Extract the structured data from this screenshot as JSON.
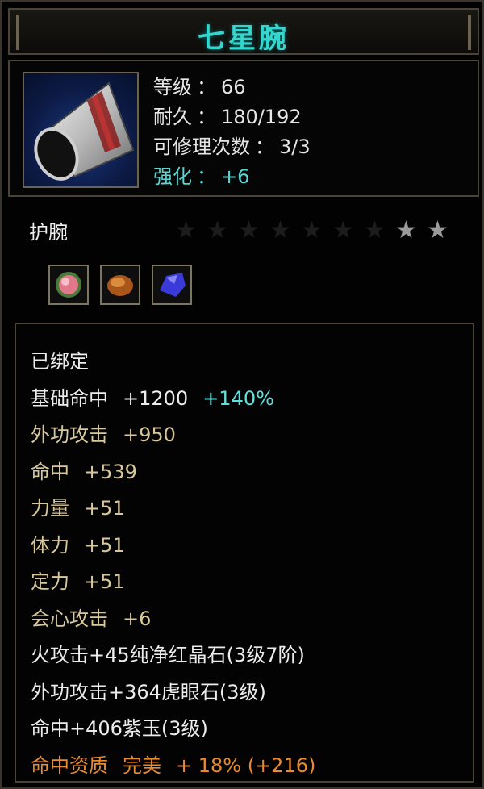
{
  "title": "七星腕",
  "header": {
    "level_label": "等级",
    "level_value": "66",
    "durability_label": "耐久",
    "durability_value": "180/192",
    "repair_label": "可修理次数",
    "repair_value": "3/3",
    "enhance_label": "强化",
    "enhance_value": "+6",
    "colon": "："
  },
  "subtype": "护腕",
  "stars": {
    "total": 9,
    "filled": 2
  },
  "sockets": [
    {
      "icon": "pink-gem-icon"
    },
    {
      "icon": "tiger-eye-stone-icon"
    },
    {
      "icon": "purple-jade-icon"
    }
  ],
  "attributes": {
    "bound": "已绑定",
    "base_hit_label": "基础命中",
    "base_hit_value": "+1200",
    "base_hit_bonus": "+140%",
    "ext_atk_label": "外功攻击",
    "ext_atk_value": "+950",
    "hit_label": "命中",
    "hit_value": "+539",
    "str_label": "力量",
    "str_value": "+51",
    "vit_label": "体力",
    "vit_value": "+51",
    "foc_label": "定力",
    "foc_value": "+51",
    "crit_label": "会心攻击",
    "crit_value": "+6",
    "gem1": "火攻击+45纯净红晶石(3级7阶)",
    "gem2": "外功攻击+364虎眼石(3级)",
    "gem3": "命中+406紫玉(3级)",
    "quality_label": "命中资质",
    "quality_grade": "完美",
    "quality_value": "+ 18% (+216)"
  },
  "colors": {
    "title": "#35d6cf",
    "cyan": "#57d7d4",
    "gold": "#d7c79b",
    "orange": "#e88a32"
  }
}
